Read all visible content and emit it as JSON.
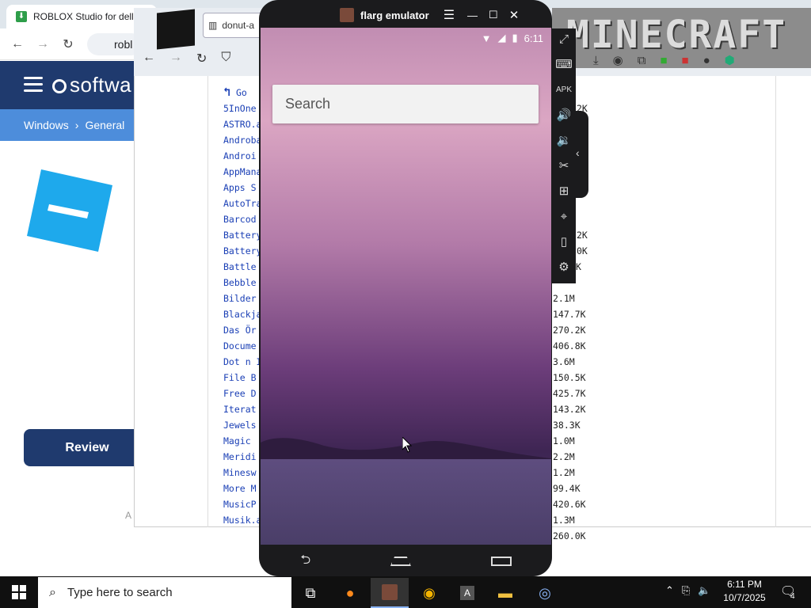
{
  "chrome": {
    "tab_title": "ROBLOX Studio for dell",
    "omnibox": "robl",
    "site_logo": "softwa",
    "breadcrumb": [
      "Windows",
      "›",
      "General"
    ],
    "review_button": "Review",
    "footer_text": "A"
  },
  "listing": {
    "tab_label": "donut-a",
    "banner_text": "MINECRAFT",
    "go_up": "Go",
    "files": [
      "5InOne",
      "ASTRO.a",
      "Androba",
      "Androi",
      "AppMana",
      "Apps S",
      "AutoTra",
      "Barcod",
      "Battery",
      "Battery",
      "Battle",
      "Bebble",
      "Bilder",
      "Blackja",
      "Das Ör",
      "Docume",
      "Dot n I",
      "File B",
      "Free D",
      "Iterat",
      "Jewels",
      "Magic",
      "Meridi",
      "Minesw",
      "More M",
      "MusicP",
      "Musik.a"
    ],
    "sizes": [
      {
        "row": 1,
        "text": "2K"
      },
      {
        "row": 9,
        "text": "2K"
      },
      {
        "row": 10,
        "text": "0K"
      },
      {
        "row": 11,
        "text": "K"
      },
      {
        "row": 13,
        "text": "2.1M"
      },
      {
        "row": 14,
        "text": "147.7K"
      },
      {
        "row": 15,
        "text": "270.2K"
      },
      {
        "row": 16,
        "text": "406.8K"
      },
      {
        "row": 17,
        "text": "3.6M"
      },
      {
        "row": 18,
        "text": "150.5K"
      },
      {
        "row": 19,
        "text": "425.7K"
      },
      {
        "row": 20,
        "text": "143.2K"
      },
      {
        "row": 21,
        "text": "38.3K"
      },
      {
        "row": 22,
        "text": "1.0M"
      },
      {
        "row": 23,
        "text": "2.2M"
      },
      {
        "row": 24,
        "text": "1.2M"
      },
      {
        "row": 25,
        "text": "99.4K"
      },
      {
        "row": 26,
        "text": "420.6K"
      },
      {
        "row": 27,
        "text": "1.3M"
      },
      {
        "row": 28,
        "text": "260.0K"
      }
    ]
  },
  "emulator": {
    "title": "flarg emulator",
    "time": "6:11",
    "search_placeholder": "Search"
  },
  "taskbar": {
    "search_placeholder": "Type here to search",
    "clock_time": "6:11 PM",
    "clock_date": "10/7/2025",
    "notifications": "4"
  }
}
